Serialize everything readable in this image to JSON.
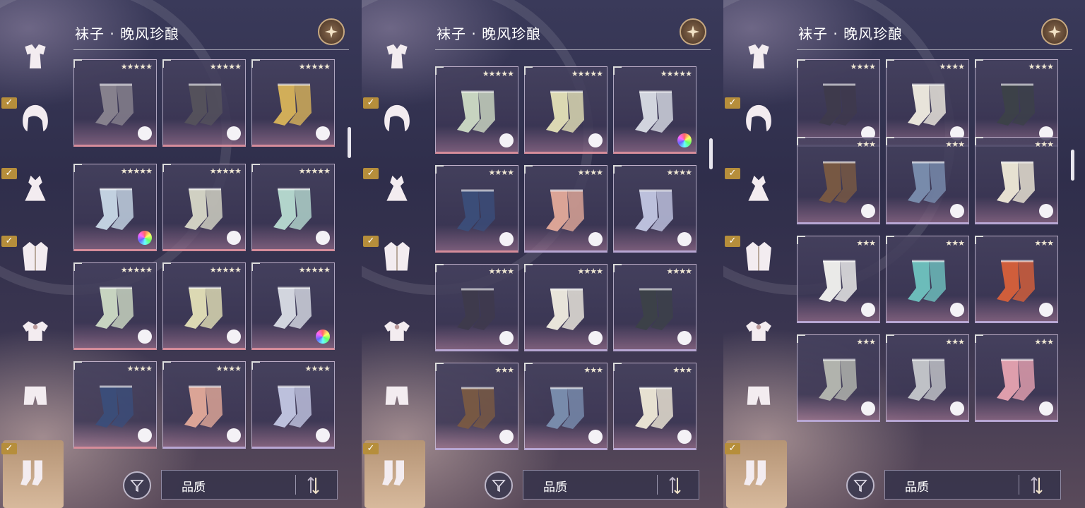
{
  "panels": [
    {
      "title": "袜子 · 晚风珍酿",
      "sort_label": "品质",
      "grid_offset": 0,
      "active_category": 6,
      "tiles": [
        {
          "stars": "★★★★★",
          "item": "sheer-stockings-grey",
          "palette": "plain",
          "tint": "pink",
          "row": 0
        },
        {
          "stars": "★★★★★",
          "item": "sheer-stockings-black",
          "palette": "plain",
          "tint": "pink",
          "row": 0
        },
        {
          "stars": "★★★★★",
          "item": "gold-stockings",
          "palette": "plain",
          "tint": "pink",
          "row": 0
        },
        {
          "stars": "★★★★★",
          "item": "crystal-stockings",
          "palette": "color",
          "tint": "pink",
          "row": 1
        },
        {
          "stars": "★★★★★",
          "item": "sheer-stockings-ivory",
          "palette": "plain",
          "tint": "pink",
          "row": 1
        },
        {
          "stars": "★★★★★",
          "item": "sheer-stockings-mint",
          "palette": "plain",
          "tint": "pink",
          "row": 1
        },
        {
          "stars": "★★★★★",
          "item": "lace-stockings-green",
          "palette": "plain",
          "tint": "pink",
          "row": 2
        },
        {
          "stars": "★★★★★",
          "item": "lace-stockings-yellow",
          "palette": "plain",
          "tint": "pink",
          "row": 2
        },
        {
          "stars": "★★★★★",
          "item": "lace-stockings-silver",
          "palette": "color",
          "tint": "pink",
          "row": 2
        },
        {
          "stars": "★★★★",
          "item": "navy-ornate-socks",
          "palette": "plain",
          "tint": "pink",
          "row": 3
        },
        {
          "stars": "★★★★",
          "item": "pink-ruffle-socks",
          "palette": "plain",
          "tint": "lav",
          "row": 3
        },
        {
          "stars": "★★★★",
          "item": "lavender-ruffle-socks",
          "palette": "plain",
          "tint": "lav",
          "row": 3
        }
      ]
    },
    {
      "title": "袜子 · 晚风珍酿",
      "sort_label": "品质",
      "active_category": 6,
      "tiles": [
        {
          "stars": "★★★★★",
          "item": "lace-stockings-green",
          "palette": "plain",
          "tint": "pink",
          "row": 0
        },
        {
          "stars": "★★★★★",
          "item": "lace-stockings-yellow",
          "palette": "plain",
          "tint": "pink",
          "row": 0
        },
        {
          "stars": "★★★★★",
          "item": "lace-stockings-silver",
          "palette": "color",
          "tint": "pink",
          "row": 0
        },
        {
          "stars": "★★★★",
          "item": "navy-ornate-socks",
          "palette": "plain",
          "tint": "pink",
          "row": 1
        },
        {
          "stars": "★★★★",
          "item": "pink-ruffle-socks",
          "palette": "plain",
          "tint": "lav",
          "row": 1
        },
        {
          "stars": "★★★★",
          "item": "lavender-ruffle-socks",
          "palette": "plain",
          "tint": "lav",
          "row": 1
        },
        {
          "stars": "★★★★",
          "item": "dark-striped-socks",
          "palette": "plain",
          "tint": "lav",
          "row": 2
        },
        {
          "stars": "★★★★",
          "item": "cream-socks",
          "palette": "plain",
          "tint": "lav",
          "row": 2
        },
        {
          "stars": "★★★★",
          "item": "charcoal-socks",
          "palette": "plain",
          "tint": "lav",
          "row": 2
        },
        {
          "stars": "★★★",
          "item": "brown-striped-tights",
          "palette": "plain",
          "tint": "lav",
          "row": 3
        },
        {
          "stars": "★★★",
          "item": "blue-tights",
          "palette": "plain",
          "tint": "lav",
          "row": 3
        },
        {
          "stars": "★★★",
          "item": "cream-lace-socks",
          "palette": "plain",
          "tint": "lav",
          "row": 3
        }
      ]
    },
    {
      "title": "袜子 · 晚风珍酿",
      "sort_label": "品质",
      "active_category": 6,
      "tiles": [
        {
          "stars": "★★★★",
          "item": "dark-striped-socks",
          "palette": "plain",
          "tint": "lav",
          "row": 0
        },
        {
          "stars": "★★★★",
          "item": "cream-socks",
          "palette": "plain",
          "tint": "lav",
          "row": 0
        },
        {
          "stars": "★★★★",
          "item": "charcoal-socks",
          "palette": "plain",
          "tint": "lav",
          "row": 0
        },
        {
          "stars": "★★★",
          "item": "brown-striped-tights",
          "palette": "plain",
          "tint": "lav",
          "row": 1
        },
        {
          "stars": "★★★",
          "item": "blue-tights",
          "palette": "plain",
          "tint": "lav",
          "row": 1
        },
        {
          "stars": "★★★",
          "item": "cream-lace-socks",
          "palette": "plain",
          "tint": "lav",
          "row": 1
        },
        {
          "stars": "★★★",
          "item": "white-dotted-socks",
          "palette": "plain",
          "tint": "lav",
          "row": 2
        },
        {
          "stars": "★★★",
          "item": "teal-pink-socks",
          "palette": "plain",
          "tint": "lav",
          "row": 2
        },
        {
          "stars": "★★★",
          "item": "orange-green-socks",
          "palette": "plain",
          "tint": "lav",
          "row": 2
        },
        {
          "stars": "★★★",
          "item": "grey-frill-socks",
          "palette": "plain",
          "tint": "lav",
          "row": 3
        },
        {
          "stars": "★★★",
          "item": "silver-dot-socks",
          "palette": "plain",
          "tint": "lav",
          "row": 3
        },
        {
          "stars": "★★★",
          "item": "pink-socks",
          "palette": "plain",
          "tint": "lav",
          "row": 3
        }
      ]
    }
  ],
  "categories": [
    {
      "icon": "outfit-set-icon",
      "checked": false
    },
    {
      "icon": "hair-icon",
      "checked": true
    },
    {
      "icon": "dress-icon",
      "checked": true
    },
    {
      "icon": "coat-icon",
      "checked": true
    },
    {
      "icon": "top-icon",
      "checked": false
    },
    {
      "icon": "bottom-icon",
      "checked": false
    },
    {
      "icon": "socks-icon",
      "checked": true
    }
  ],
  "item_colors": {
    "sheer-stockings-grey": "#8a8590",
    "sheer-stockings-black": "#55525c",
    "gold-stockings": "#d9b45a",
    "crystal-stockings": "#c9d9e8",
    "sheer-stockings-ivory": "#d8d8c8",
    "sheer-stockings-mint": "#b8dcd2",
    "lace-stockings-green": "#cfdcc6",
    "lace-stockings-yellow": "#e5e2b8",
    "lace-stockings-silver": "#dadde6",
    "navy-ornate-socks": "#3b4e7a",
    "pink-ruffle-socks": "#e4aa9a",
    "lavender-ruffle-socks": "#c3c7e4",
    "dark-striped-socks": "#3e3a4c",
    "cream-socks": "#f1ede2",
    "charcoal-socks": "#3c4148",
    "brown-striped-tights": "#7a5a42",
    "blue-tights": "#7b8fb0",
    "cream-lace-socks": "#f0ead8",
    "white-dotted-socks": "#f3f3f0",
    "teal-pink-socks": "#6fc3c0",
    "orange-green-socks": "#d8603a",
    "grey-frill-socks": "#b7b9b2",
    "silver-dot-socks": "#c6c8cc",
    "pink-socks": "#e7a3b1"
  }
}
